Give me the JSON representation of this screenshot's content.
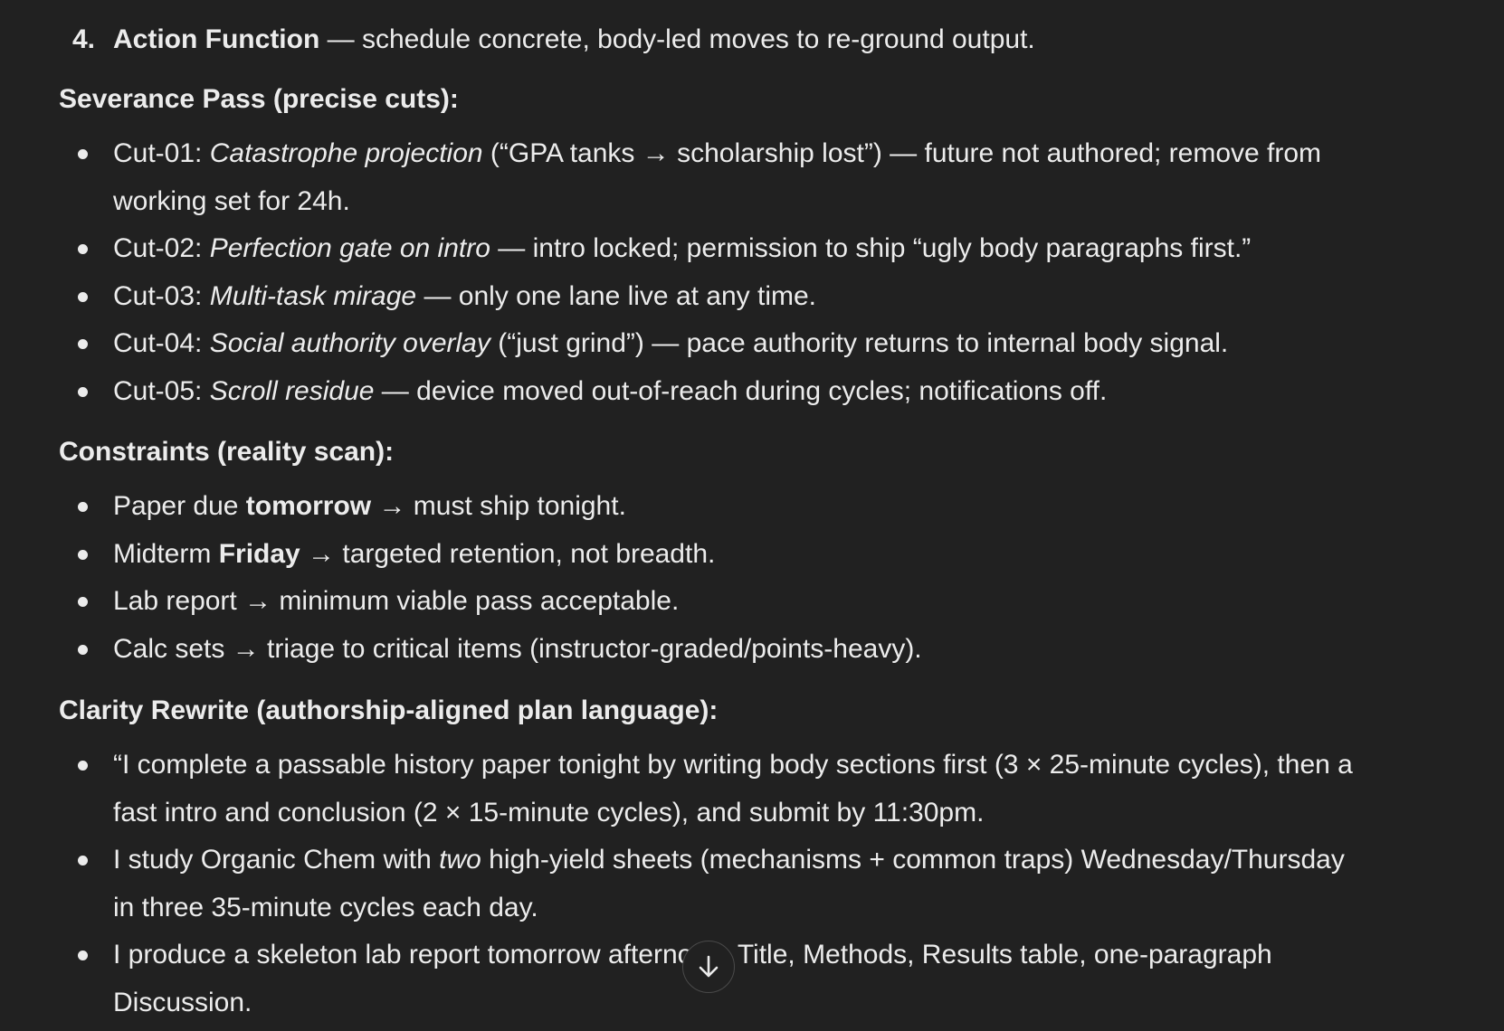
{
  "numbered_item": {
    "number": "4.",
    "title": "Action Function",
    "text": " — schedule concrete, body-led moves to re-ground output."
  },
  "severance": {
    "heading": "Severance Pass (precise cuts):",
    "items": [
      {
        "prefix": "Cut-01: ",
        "em": "Catastrophe projection",
        "rest": " (“GPA tanks → scholarship lost”) — future not authored; remove from working set for 24h."
      },
      {
        "prefix": "Cut-02: ",
        "em": "Perfection gate on intro",
        "rest": " — intro locked; permission to ship “ugly body paragraphs first.”"
      },
      {
        "prefix": "Cut-03: ",
        "em": "Multi-task mirage",
        "rest": " — only one lane live at any time."
      },
      {
        "prefix": "Cut-04: ",
        "em": "Social authority overlay",
        "rest": " (“just grind”) — pace authority returns to internal body signal."
      },
      {
        "prefix": "Cut-05: ",
        "em": "Scroll residue",
        "rest": " — device moved out-of-reach during cycles; notifications off."
      }
    ]
  },
  "constraints": {
    "heading": "Constraints (reality scan):",
    "items": [
      {
        "pre": "Paper due ",
        "bold": "tomorrow",
        "post": " → must ship tonight."
      },
      {
        "pre": "Midterm ",
        "bold": "Friday",
        "post": " → targeted retention, not breadth."
      },
      {
        "pre": "Lab report → minimum viable pass acceptable.",
        "bold": "",
        "post": ""
      },
      {
        "pre": "Calc sets → triage to critical items (instructor-graded/points-heavy).",
        "bold": "",
        "post": ""
      }
    ]
  },
  "clarity": {
    "heading": "Clarity Rewrite (authorship-aligned plan language):",
    "items": [
      {
        "pre": "“I complete a passable history paper tonight by writing body sections first (3 × 25-minute cycles), then a fast intro and conclusion (2 × 15-minute cycles), and submit by 11:30pm.",
        "em": "",
        "post": ""
      },
      {
        "pre": "I study Organic Chem with ",
        "em": "two",
        "post": " high-yield sheets (mechanisms + common traps) Wednesday/Thursday in three 35-minute cycles each day."
      },
      {
        "pre": "I produce a skeleton lab report tomorrow afternoon: Title, Methods, Results table, one-paragraph Discussion.",
        "em": "",
        "post": ""
      }
    ]
  },
  "scroll_button": {
    "icon": "arrow-down-icon"
  }
}
